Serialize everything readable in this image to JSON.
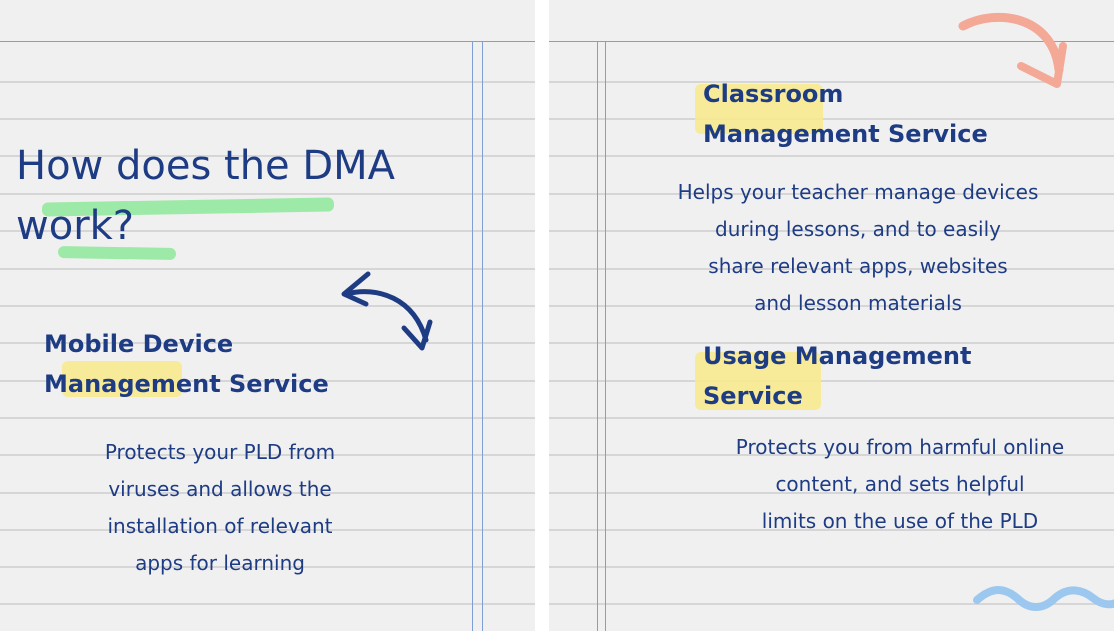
{
  "left_page": {
    "title_line1": "How does the DMA",
    "title_line2": "work?",
    "mdm_heading_line1": "Mobile Device",
    "mdm_heading_line2": "Management Service",
    "mdm_body": [
      "Protects your PLD from",
      "viruses and allows the",
      "installation of relevant",
      "apps for learning"
    ]
  },
  "right_page": {
    "cms_heading_line1": "Classroom",
    "cms_heading_line2": "Management Service",
    "cms_body": [
      "Helps your teacher manage devices",
      "during lessons, and to easily",
      "share relevant apps, websites",
      "and lesson materials"
    ],
    "ums_heading_line1": "Usage Management",
    "ums_heading_line2": "Service",
    "ums_body": [
      "Protects you from harmful online",
      "content, and sets helpful",
      "limits on the use of the PLD"
    ]
  },
  "colors": {
    "text": "#1e3c84",
    "paper": "#f0f0f0",
    "rule": "#d6d6d6",
    "margin_line": "#7e9ed4",
    "highlight_green": "#8ee89a",
    "highlight_yellow": "#f7e98e",
    "arrow_blue": "#1e3c84",
    "arrow_salmon": "#f4a896",
    "squiggle_blue": "#9cc8f0"
  },
  "icons": [
    "curved-double-arrow-icon",
    "curved-arrow-icon",
    "squiggle-icon"
  ]
}
